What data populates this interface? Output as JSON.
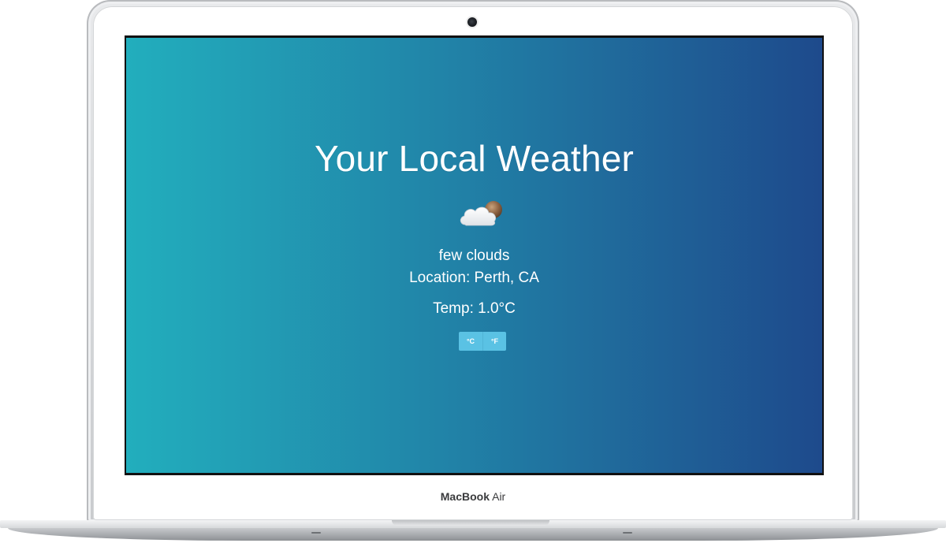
{
  "device": {
    "brand_bold": "MacBook",
    "brand_light": "Air"
  },
  "app": {
    "title": "Your Local Weather",
    "weather_icon": "few-clouds-icon",
    "description": "few clouds",
    "location": "Location: Perth, CA",
    "temperature": "Temp: 1.0°C",
    "unit_buttons": {
      "celsius_label": "°C",
      "fahrenheit_label": "°F"
    }
  },
  "colors": {
    "gradient_left": "#22aebd",
    "gradient_right": "#1e4a8c",
    "unit_button": "#5ac2e4"
  }
}
